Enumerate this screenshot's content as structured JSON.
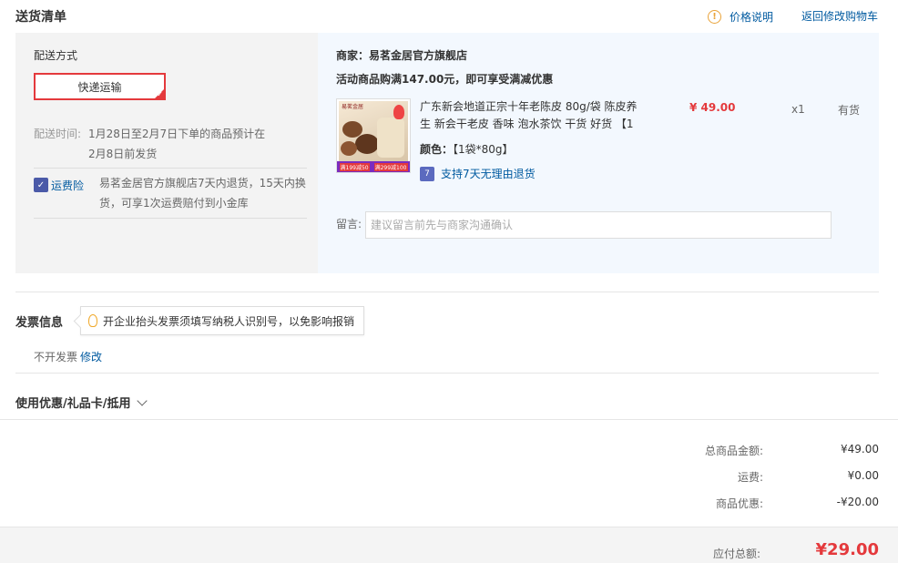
{
  "header": {
    "title": "送货清单",
    "price_note": "价格说明",
    "back_link": "返回修改购物车"
  },
  "shipping": {
    "label": "配送方式",
    "method": "快递运输",
    "time_label": "配送时间:",
    "time_value": "1月28日至2月7日下单的商品预计在2月8日前发货",
    "insurance_label": "运费险",
    "insurance_desc": "易茗金居官方旗舰店7天内退货，15天内换货，可享1次运费赔付到小金库"
  },
  "order": {
    "merchant": "商家：易茗金居官方旗舰店",
    "promo": "活动商品购满147.00元，即可享受满减优惠",
    "product": {
      "name": "广东新会地道正宗十年老陈皮 80g/袋 陈皮养生 新会干老皮 香味 泡水茶饮 干货 好货 【1",
      "color_label": "颜色：",
      "color_value": "【1袋*80g】",
      "return_policy": "支持7天无理由退货",
      "price": "¥ 49.00",
      "qty": "x1",
      "stock": "有货",
      "thumb_brand": "易茗金居",
      "thumb_promo_1": "满199减50",
      "thumb_promo_2": "满299减100"
    },
    "message_label": "留言:",
    "message_placeholder": "建议留言前先与商家沟通确认"
  },
  "invoice": {
    "title": "发票信息",
    "tip": "开企业抬头发票须填写纳税人识别号，以免影响报销",
    "status": "不开发票",
    "edit": "修改"
  },
  "coupon": {
    "label": "使用优惠/礼品卡/抵用"
  },
  "summary": {
    "total_label": "总商品金额:",
    "total_value": "¥49.00",
    "shipping_label": "运费:",
    "shipping_value": "¥0.00",
    "discount_label": "商品优惠:",
    "discount_value": "-¥20.00",
    "due_label": "应付总额:",
    "due_value": "¥29.00"
  },
  "colors": {
    "accent_red": "#e4393c",
    "link_blue": "#005aa0"
  }
}
